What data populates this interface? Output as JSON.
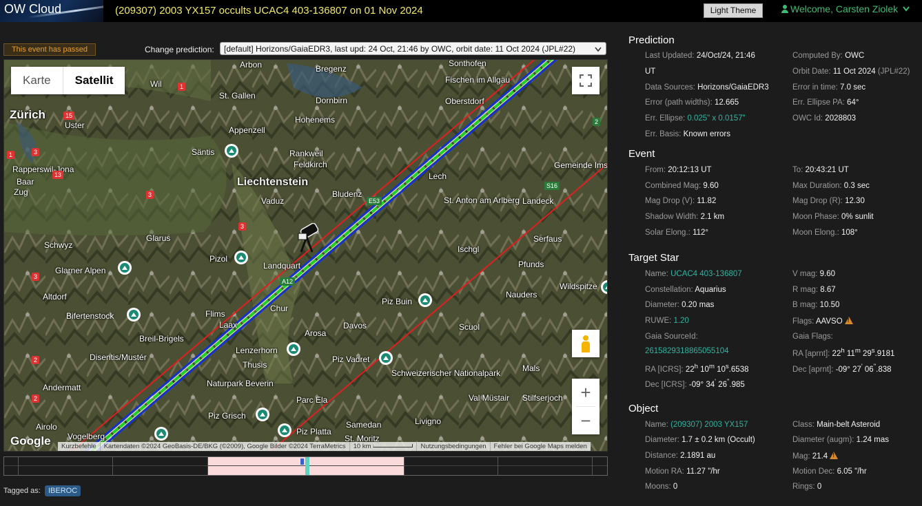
{
  "header": {
    "logo": "OW Cloud",
    "event_title": "(209307) 2003 YX157 occults UCAC4 403-136807 on 01 Nov 2024",
    "theme_button": "Light Theme",
    "welcome": "Welcome, Carsten Ziolek",
    "user_icon": "user-icon",
    "dropdown_icon": "chevron-down-icon"
  },
  "toolbar": {
    "passed_badge": "This event has passed",
    "change_label": "Change prediction:",
    "prediction_selected": "[default] Horizons/GaiaEDR3, last upd: 24 Oct, 21:46 by OWC, orbit date: 11 Oct 2024 (JPL#22)"
  },
  "map": {
    "type_buttons": [
      "Karte",
      "Satellit"
    ],
    "selected_type": "Satellit",
    "labels": [
      "Arbon",
      "Bregenz",
      "Sonthofen",
      "Wil",
      "St. Gallen",
      "Fischen im Allgäu",
      "Oberstdorf",
      "Zürich",
      "Uster",
      "Dornbirn",
      "Hohenems",
      "Appenzell",
      "Säntis",
      "Rankweil",
      "Feldkirch",
      "Rapperswil-Jona",
      "Liechtenstein",
      "Vaduz",
      "Bludenz",
      "Baar",
      "Zug",
      "Gemeinde Ims",
      "St. Anton am Arlberg",
      "Landeck",
      "Schwyz",
      "Glarus",
      "Pizol",
      "Serfaus",
      "Glarner Alpen",
      "Landquart",
      "Ischgl",
      "Pfunds",
      "Altdorf",
      "Chur",
      "Piz Buin",
      "Nauders",
      "Wildspitze",
      "Bifertenstock",
      "Flims",
      "Laax",
      "Davos",
      "Scuol",
      "Breil-Brigels",
      "Arosa",
      "Lenzerhorn",
      "Piz Vadret",
      "Disentis/Mustér",
      "Thusis",
      "Schweizerischer Nationalpark",
      "Mals",
      "Andermatt",
      "Naturpark Beverin",
      "Parc Ela",
      "Val Müstair",
      "Stilfserjoch",
      "Airolo",
      "Piz Grisch",
      "Livigno",
      "Vogelberg",
      "Piz Platta",
      "Samedan",
      "St. Moritz",
      "Lech",
      "Landeck"
    ],
    "roads": [
      "1",
      "15",
      "1",
      "3",
      "13",
      "3",
      "3",
      "3",
      "2",
      "2",
      "2",
      "E53",
      "S16",
      "A12",
      "A13"
    ],
    "attribution": [
      "Kurzbefehle",
      "Kartendaten ©2024 GeoBasis-DE/BKG (©2009), Google Bilder ©2024 TerraMetrics",
      "10 km",
      "Nutzungsbedingungen",
      "Fehler bei Google Maps melden"
    ],
    "google": "Google",
    "zoom_in": "+",
    "zoom_out": "−",
    "fullscreen_icon": "fullscreen-icon",
    "pegman_icon": "pegman-icon",
    "observer_icon": "telescope-icon",
    "colors": {
      "path_center": "#22d022",
      "path_edge": "#1030e0",
      "sigma": "#e02020"
    }
  },
  "timeline": {
    "progress_note": ""
  },
  "tags": {
    "label": "Tagged as:",
    "items": [
      "IBEROC"
    ]
  },
  "prediction": {
    "title": "Prediction",
    "rows": [
      {
        "l": "Last Updated:",
        "v": "24/Oct/24, 21:46"
      },
      {
        "l": "",
        "v": "UT"
      },
      {
        "l": "Computed By:",
        "v": "OWC"
      },
      {
        "l": "Orbit Date:",
        "v": "11 Oct 2024",
        "v2": "(JPL#22)"
      },
      {
        "l": "Data Sources:",
        "v": "Horizons/GaiaEDR3"
      },
      {
        "l": "Error in time:",
        "v": "7.0 sec"
      },
      {
        "l": "Error (path widths):",
        "v": "12.665"
      },
      {
        "l": "Err. Ellipse PA:",
        "v": "64°"
      },
      {
        "l": "Err. Ellipse:",
        "v": "0.025\" x 0.0157\""
      },
      {
        "l": "OWC Id:",
        "v": "2028803"
      },
      {
        "l": "Err. Basis:",
        "v": "Known errors"
      }
    ]
  },
  "event": {
    "title": "Event",
    "rows": [
      {
        "l": "From:",
        "v": "20:12:13 UT"
      },
      {
        "l": "To:",
        "v": "20:43:21 UT"
      },
      {
        "l": "Combined Mag:",
        "v": "9.60"
      },
      {
        "l": "Max Duration:",
        "v": "0.3 sec"
      },
      {
        "l": "Mag Drop (V):",
        "v": "11.82"
      },
      {
        "l": "Mag Drop (R):",
        "v": "12.30"
      },
      {
        "l": "Shadow Width:",
        "v": "2.1 km"
      },
      {
        "l": "Moon Phase:",
        "v": "0% sunlit"
      },
      {
        "l": "Solar Elong.:",
        "v": "112°"
      },
      {
        "l": "Moon Elong.:",
        "v": "108°"
      }
    ]
  },
  "target_star": {
    "title": "Target Star",
    "rows": [
      {
        "l": "Name:",
        "v": "UCAC4 403-136807"
      },
      {
        "l": "V mag:",
        "v": "9.60"
      },
      {
        "l": "Constellation:",
        "v": "Aquarius"
      },
      {
        "l": "R mag:",
        "v": "8.67"
      },
      {
        "l": "Diameter:",
        "v": "0.20 mas"
      },
      {
        "l": "B mag:",
        "v": "10.50"
      },
      {
        "l": "RUWE:",
        "v": "1.20"
      },
      {
        "l": "Flags:",
        "v": "AAVSO"
      },
      {
        "l": "Gaia SourceId:",
        "v": ""
      },
      {
        "l": "Gaia Flags:",
        "v": ""
      },
      {
        "l": "",
        "v": "2615829318865055104"
      },
      {
        "l": "RA [aprnt]:",
        "v": "22h 11m 29s.9181"
      },
      {
        "l": "RA [ICRS]:",
        "v": "22h 10m 10s.6538"
      },
      {
        "l": "Dec [aprnt]:",
        "v": "-09° 27' 06\".838"
      },
      {
        "l": "Dec [ICRS]:",
        "v": "-09° 34' 26\".985"
      }
    ]
  },
  "object": {
    "title": "Object",
    "rows": [
      {
        "l": "Name:",
        "v": "(209307) 2003 YX157"
      },
      {
        "l": "Class:",
        "v": "Main-belt Asteroid"
      },
      {
        "l": "Diameter:",
        "v": "1.7 ± 0.2 km",
        "v2": "(Occult)"
      },
      {
        "l": "Diameter (augm):",
        "v": "1.24 mas"
      },
      {
        "l": "Distance:",
        "v": "2.1891 au"
      },
      {
        "l": "Mag:",
        "v": "21.4"
      },
      {
        "l": "Motion RA:",
        "v": "11.27 \"/hr"
      },
      {
        "l": "Motion Dec:",
        "v": "6.05 \"/hr"
      },
      {
        "l": "Moons:",
        "v": "0"
      },
      {
        "l": "Rings:",
        "v": "0"
      }
    ]
  }
}
